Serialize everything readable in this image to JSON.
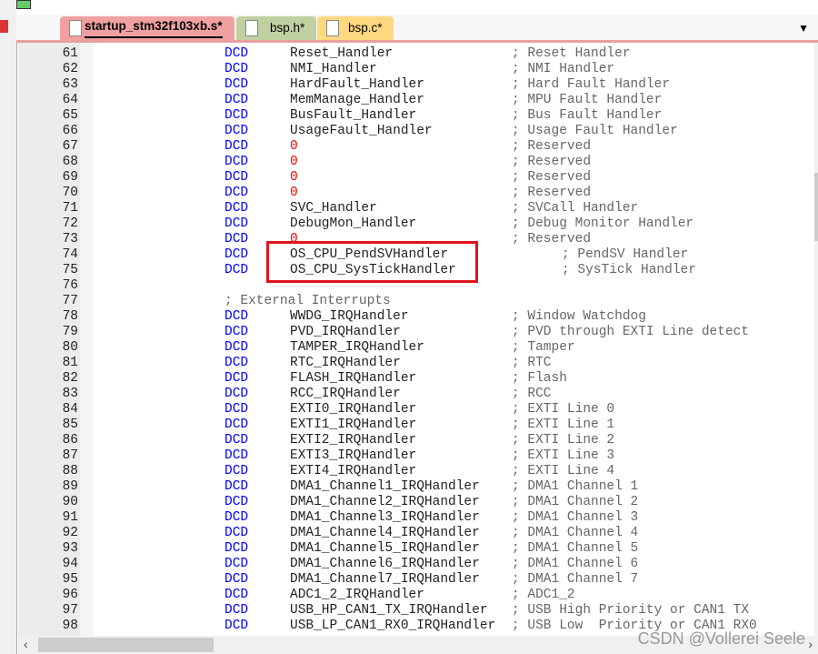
{
  "tabs": [
    {
      "label": "startup_stm32f103xb.s*",
      "color": "#f0a0a0",
      "active": true
    },
    {
      "label": "bsp.h*",
      "color": "#c0d0a0"
    },
    {
      "label": "bsp.c*",
      "color": "#ffd880"
    }
  ],
  "dropdown_icon": "triangle-down-icon",
  "lines": [
    {
      "n": "61",
      "kw": "DCD",
      "arg": "Reset_Handler",
      "cm": "; Reset Handler"
    },
    {
      "n": "62",
      "kw": "DCD",
      "arg": "NMI_Handler",
      "cm": "; NMI Handler"
    },
    {
      "n": "63",
      "kw": "DCD",
      "arg": "HardFault_Handler",
      "cm": "; Hard Fault Handler"
    },
    {
      "n": "64",
      "kw": "DCD",
      "arg": "MemManage_Handler",
      "cm": "; MPU Fault Handler"
    },
    {
      "n": "65",
      "kw": "DCD",
      "arg": "BusFault_Handler",
      "cm": "; Bus Fault Handler"
    },
    {
      "n": "66",
      "kw": "DCD",
      "arg": "UsageFault_Handler",
      "cm": "; Usage Fault Handler"
    },
    {
      "n": "67",
      "kw": "DCD",
      "arg": "0",
      "cm": "; Reserved",
      "num": true
    },
    {
      "n": "68",
      "kw": "DCD",
      "arg": "0",
      "cm": "; Reserved",
      "num": true
    },
    {
      "n": "69",
      "kw": "DCD",
      "arg": "0",
      "cm": "; Reserved",
      "num": true
    },
    {
      "n": "70",
      "kw": "DCD",
      "arg": "0",
      "cm": "; Reserved",
      "num": true
    },
    {
      "n": "71",
      "kw": "DCD",
      "arg": "SVC_Handler",
      "cm": "; SVCall Handler"
    },
    {
      "n": "72",
      "kw": "DCD",
      "arg": "DebugMon_Handler",
      "cm": "; Debug Monitor Handler"
    },
    {
      "n": "73",
      "kw": "DCD",
      "arg": "0",
      "cm": "; Reserved",
      "num": true
    },
    {
      "n": "74",
      "kw": "DCD",
      "arg": "OS_CPU_PendSVHandler",
      "cm": "; PendSV Handler",
      "far": true
    },
    {
      "n": "75",
      "kw": "DCD",
      "arg": "OS_CPU_SysTickHandler",
      "cm": "; SysTick Handler",
      "far": true
    },
    {
      "n": "76"
    },
    {
      "n": "77",
      "comment_only": "; External Interrupts"
    },
    {
      "n": "78",
      "kw": "DCD",
      "arg": "WWDG_IRQHandler",
      "cm": "; Window Watchdog"
    },
    {
      "n": "79",
      "kw": "DCD",
      "arg": "PVD_IRQHandler",
      "cm": "; PVD through EXTI Line detect"
    },
    {
      "n": "80",
      "kw": "DCD",
      "arg": "TAMPER_IRQHandler",
      "cm": "; Tamper"
    },
    {
      "n": "81",
      "kw": "DCD",
      "arg": "RTC_IRQHandler",
      "cm": "; RTC"
    },
    {
      "n": "82",
      "kw": "DCD",
      "arg": "FLASH_IRQHandler",
      "cm": "; Flash"
    },
    {
      "n": "83",
      "kw": "DCD",
      "arg": "RCC_IRQHandler",
      "cm": "; RCC"
    },
    {
      "n": "84",
      "kw": "DCD",
      "arg": "EXTI0_IRQHandler",
      "cm": "; EXTI Line 0"
    },
    {
      "n": "85",
      "kw": "DCD",
      "arg": "EXTI1_IRQHandler",
      "cm": "; EXTI Line 1"
    },
    {
      "n": "86",
      "kw": "DCD",
      "arg": "EXTI2_IRQHandler",
      "cm": "; EXTI Line 2"
    },
    {
      "n": "87",
      "kw": "DCD",
      "arg": "EXTI3_IRQHandler",
      "cm": "; EXTI Line 3"
    },
    {
      "n": "88",
      "kw": "DCD",
      "arg": "EXTI4_IRQHandler",
      "cm": "; EXTI Line 4"
    },
    {
      "n": "89",
      "kw": "DCD",
      "arg": "DMA1_Channel1_IRQHandler",
      "cm": "; DMA1 Channel 1"
    },
    {
      "n": "90",
      "kw": "DCD",
      "arg": "DMA1_Channel2_IRQHandler",
      "cm": "; DMA1 Channel 2"
    },
    {
      "n": "91",
      "kw": "DCD",
      "arg": "DMA1_Channel3_IRQHandler",
      "cm": "; DMA1 Channel 3"
    },
    {
      "n": "92",
      "kw": "DCD",
      "arg": "DMA1_Channel4_IRQHandler",
      "cm": "; DMA1 Channel 4"
    },
    {
      "n": "93",
      "kw": "DCD",
      "arg": "DMA1_Channel5_IRQHandler",
      "cm": "; DMA1 Channel 5"
    },
    {
      "n": "94",
      "kw": "DCD",
      "arg": "DMA1_Channel6_IRQHandler",
      "cm": "; DMA1 Channel 6"
    },
    {
      "n": "95",
      "kw": "DCD",
      "arg": "DMA1_Channel7_IRQHandler",
      "cm": "; DMA1 Channel 7"
    },
    {
      "n": "96",
      "kw": "DCD",
      "arg": "ADC1_2_IRQHandler",
      "cm": "; ADC1_2"
    },
    {
      "n": "97",
      "kw": "DCD",
      "arg": "USB_HP_CAN1_TX_IRQHandler",
      "cm": "; USB High Priority or CAN1 TX"
    },
    {
      "n": "98",
      "kw": "DCD",
      "arg": "USB_LP_CAN1_RX0_IRQHandler",
      "cm": "; USB Low  Priority or CAN1 RX0"
    }
  ],
  "colors": {
    "keyword": "#0000ff",
    "number": "#ff0000",
    "comment": "#666666",
    "highlight_box": "#e0141e"
  },
  "watermark": "CSDN @Vollerei Seele"
}
